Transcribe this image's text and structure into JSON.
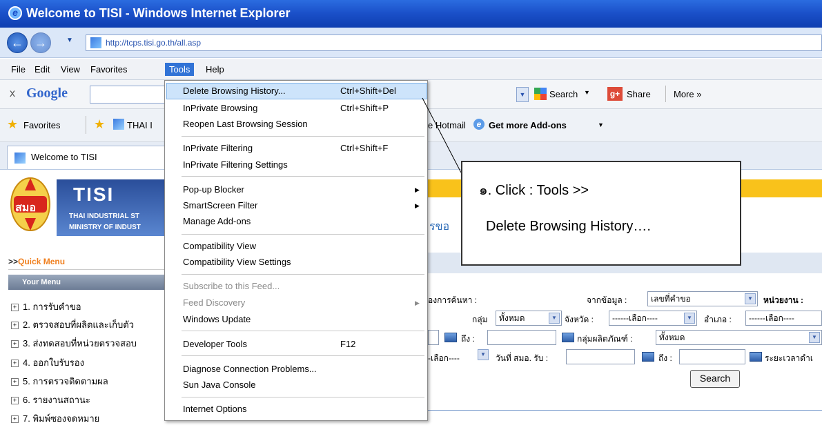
{
  "window": {
    "title": "Welcome to TISI - Windows Internet Explorer"
  },
  "address": {
    "url": "http://tcps.tisi.go.th/all.asp"
  },
  "menubar": {
    "items": [
      "File",
      "Edit",
      "View",
      "Favorites",
      "Tools",
      "Help"
    ]
  },
  "google_toolbar": {
    "logo": "Google",
    "search_label": "Search",
    "share_label": "Share",
    "more_label": "More »"
  },
  "favorites_bar": {
    "favorites_label": "Favorites",
    "thai_label": "THAI I",
    "hotmail_label": "e Hotmail",
    "addons_label": "Get more Add-ons"
  },
  "tab": {
    "title": "Welcome to TISI"
  },
  "banner": {
    "logo_text": "สมอ",
    "tisi": "TISI",
    "line1": "THAI INDUSTRIAL ST",
    "line2": "MINISTRY OF INDUST",
    "title_fragment": "รขอ"
  },
  "quick_menu": {
    "prefix": ">>",
    "label": "Quick Menu",
    "your_menu": "Your Menu"
  },
  "sidebar": {
    "items": [
      "1. การรับคำขอ",
      "2. ตรวจสอบที่ผลิตและเก็บตัว",
      "3. ส่งทดสอบที่หน่วยตรวจสอบ",
      "4. ออกใบรับรอง",
      "5. การตรวจติดตามผล",
      "6. รายงานสถานะ",
      "7. พิมพ์ซองจดหมาย"
    ]
  },
  "form": {
    "search_label": "องการค้นหา :",
    "from_data_label": "จากข้อมูล :",
    "from_data_value": "เลขที่คำขอ",
    "unit_label": "หน่วยงาน :",
    "group_label": "กลุ่ม",
    "group_value": "ทั้งหมด",
    "province_label": "จังหวัด :",
    "province_value": "------เลือก----",
    "district_label": "อำเภอ :",
    "district_value": "------เลือก----",
    "to_label": "ถึง :",
    "product_group_label": "กลุ่มผลิตภัณฑ์ :",
    "product_group_value": "ทั้งหมด",
    "select_value": "-เลือก----",
    "receive_date_label": "วันที่ สมอ. รับ :",
    "to_label2": "ถึง :",
    "duration_label": "ระยะเวลาดำเ",
    "search_button": "Search"
  },
  "tools_menu": {
    "items": [
      {
        "label": "Delete Browsing History...",
        "shortcut": "Ctrl+Shift+Del",
        "highlighted": true
      },
      {
        "label": "InPrivate Browsing",
        "shortcut": "Ctrl+Shift+P"
      },
      {
        "label": "Reopen Last Browsing Session",
        "shortcut": ""
      },
      {
        "label": "InPrivate Filtering",
        "shortcut": "Ctrl+Shift+F"
      },
      {
        "label": "InPrivate Filtering Settings",
        "shortcut": ""
      },
      {
        "label": "Pop-up Blocker",
        "shortcut": "",
        "submenu": true
      },
      {
        "label": "SmartScreen Filter",
        "shortcut": "",
        "submenu": true
      },
      {
        "label": "Manage Add-ons",
        "shortcut": ""
      },
      {
        "label": "Compatibility View",
        "shortcut": ""
      },
      {
        "label": "Compatibility View Settings",
        "shortcut": ""
      },
      {
        "label": "Subscribe to this Feed...",
        "shortcut": "",
        "disabled": true
      },
      {
        "label": "Feed Discovery",
        "shortcut": "",
        "disabled": true,
        "submenu": true
      },
      {
        "label": "Windows Update",
        "shortcut": ""
      },
      {
        "label": "Developer Tools",
        "shortcut": "F12"
      },
      {
        "label": "Diagnose Connection Problems...",
        "shortcut": ""
      },
      {
        "label": "Sun Java Console",
        "shortcut": ""
      },
      {
        "label": "Internet Options",
        "shortcut": ""
      }
    ]
  },
  "callout": {
    "line1": "๑. Click : Tools >>",
    "line2": "Delete Browsing History…."
  },
  "colors": {
    "titlebar": "#1a4fc8",
    "menu_highlight": "#cde4fb",
    "banner_orange": "#f9c21b",
    "quick_menu": "#f08020"
  }
}
